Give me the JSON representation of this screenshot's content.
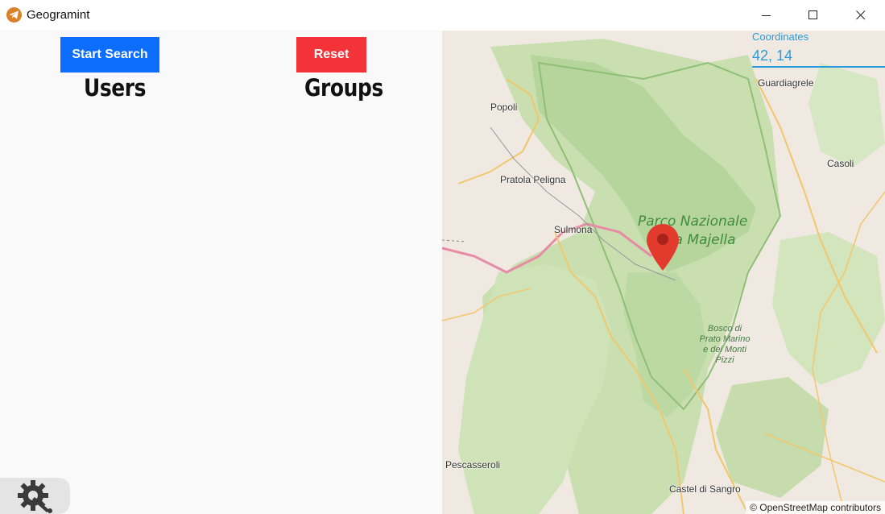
{
  "window": {
    "title": "Geogramint",
    "icon": "telegram-icon",
    "controls": [
      "minimize-icon",
      "maximize-icon",
      "close-icon"
    ]
  },
  "toolbar": {
    "start_label": "Start Search",
    "reset_label": "Reset",
    "start_color": "#0d6efd",
    "reset_color": "#f43338"
  },
  "lists": {
    "users_heading": "Users",
    "groups_heading": "Groups"
  },
  "settings": {
    "icon": "settings-gear-wrench-icon"
  },
  "map": {
    "coordinates_label": "Coordinates",
    "coordinates_value": "42, 14",
    "places": {
      "guardiagrele": "Guardiagrele",
      "popoli": "Popoli",
      "casoli": "Casoli",
      "pratola": "Pratola Peligna",
      "sulmona": "Sulmona",
      "pescasseroli": "Pescasseroli",
      "castel": "Castel di Sangro"
    },
    "park_line1": "Parco Nazionale",
    "park_line2": "della Majella",
    "bosco_lines": [
      "Bosco di",
      "Prato Marino",
      "e dei Monti",
      "Pizzi"
    ],
    "attribution": "© OpenStreetMap contributors",
    "marker": "map-marker-icon",
    "marker_color": "#e23b2e"
  }
}
